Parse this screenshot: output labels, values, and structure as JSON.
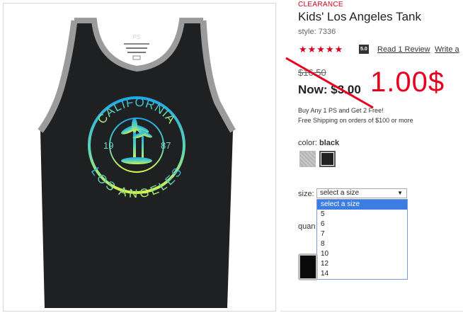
{
  "product": {
    "badge": "CLEARANCE",
    "title": "Kids' Los Angeles Tank",
    "style": "style: 7336",
    "stars": "★★★★★",
    "rating": "5.0",
    "review_link": "Read 1 Review",
    "write_link": "Write a"
  },
  "pricing": {
    "old_price": "$16.50",
    "now_label": "Now: $3.00",
    "annotation": "1.00$",
    "promo": "Buy Any 1 PS and Get 2 Free!",
    "shipping": "Free Shipping on orders of $100 or more"
  },
  "color": {
    "label": "color:",
    "value": "black",
    "swatches": [
      "gray-swatch",
      "black-swatch"
    ]
  },
  "shirt_print": {
    "brand": "PS",
    "top_text": "CALIFORNIA",
    "bottom_text": "LOS ANGELES",
    "year_left": "19",
    "year_right": "87"
  },
  "size": {
    "label": "size:",
    "selected": "select a size",
    "options": [
      "select a size",
      "5",
      "6",
      "7",
      "8",
      "10",
      "12",
      "14"
    ]
  },
  "quantity": {
    "label": "quan"
  },
  "colors": {
    "accent": "#d6001c",
    "annotation": "#e8001c",
    "dropdown_highlight": "#3b7de0"
  }
}
